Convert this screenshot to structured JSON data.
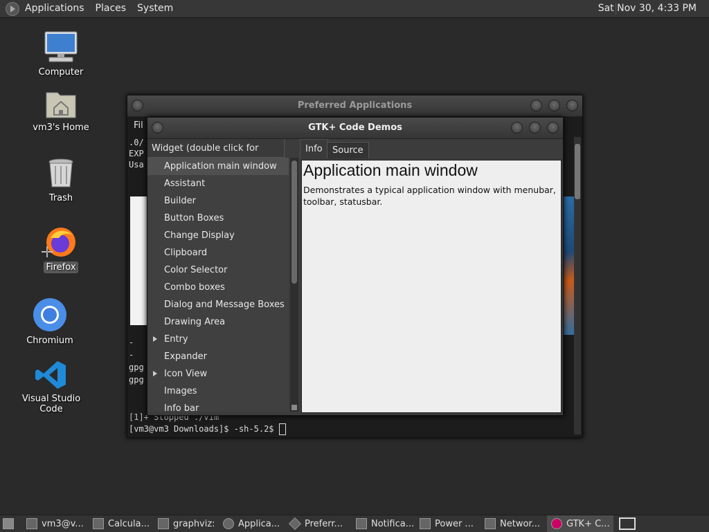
{
  "top_panel": {
    "menus": [
      "Applications",
      "Places",
      "System"
    ],
    "clock": "Sat Nov 30,  4:33 PM"
  },
  "desktop_icons": [
    {
      "label": "Computer",
      "icon": "computer-icon"
    },
    {
      "label": "vm3's Home",
      "icon": "home-folder-icon"
    },
    {
      "label": "Trash",
      "icon": "trash-icon"
    },
    {
      "label": "Firefox",
      "icon": "firefox-icon"
    },
    {
      "label": "Chromium",
      "icon": "chromium-icon"
    },
    {
      "label": "Visual Studio Code",
      "icon": "vscode-icon"
    }
  ],
  "pref_window": {
    "title": "Preferred Applications",
    "menu_fragment": "Fil",
    "terminal_lines": [
      ".0/",
      "EXP",
      "Usa"
    ],
    "terminal_lines_lower": [
      "  -",
      "  -",
      "gpg",
      "gpg"
    ],
    "stopped_line": "[1]+  Stopped                 ./vim",
    "prompt": "[vm3@vm3 Downloads]$ -sh-5.2$ "
  },
  "gtk_window": {
    "title": "GTK+ Code Demos",
    "list_header": "Widget (double click for demo)",
    "tabs": [
      "Info",
      "Source"
    ],
    "items": [
      {
        "label": "Application main window",
        "expandable": false,
        "selected": true
      },
      {
        "label": "Assistant",
        "expandable": false
      },
      {
        "label": "Builder",
        "expandable": false
      },
      {
        "label": "Button Boxes",
        "expandable": false
      },
      {
        "label": "Change Display",
        "expandable": false
      },
      {
        "label": "Clipboard",
        "expandable": false
      },
      {
        "label": "Color Selector",
        "expandable": false
      },
      {
        "label": "Combo boxes",
        "expandable": false
      },
      {
        "label": "Dialog and Message Boxes",
        "expandable": false
      },
      {
        "label": "Drawing Area",
        "expandable": false
      },
      {
        "label": "Entry",
        "expandable": true
      },
      {
        "label": "Expander",
        "expandable": false
      },
      {
        "label": "Icon View",
        "expandable": true
      },
      {
        "label": "Images",
        "expandable": false
      },
      {
        "label": "Info bar",
        "expandable": false
      }
    ],
    "info_title": "Application main window",
    "info_description": "Demonstrates a typical application window with menubar, toolbar, statusbar."
  },
  "taskbar": {
    "items": [
      {
        "label": "vm3@v...",
        "icon": "terminal-icon"
      },
      {
        "label": "Calcula...",
        "icon": "calculator-icon"
      },
      {
        "label": "graphviz:",
        "icon": "graphviz-icon"
      },
      {
        "label": "Applica...",
        "icon": "application-icon"
      },
      {
        "label": "Preferr...",
        "icon": "preferences-icon"
      },
      {
        "label": "Notifica...",
        "icon": "notification-icon"
      },
      {
        "label": "Power ...",
        "icon": "power-icon"
      },
      {
        "label": "Networ...",
        "icon": "network-icon"
      },
      {
        "label": "GTK+ C...",
        "icon": "gtk-icon",
        "active": true
      }
    ]
  }
}
